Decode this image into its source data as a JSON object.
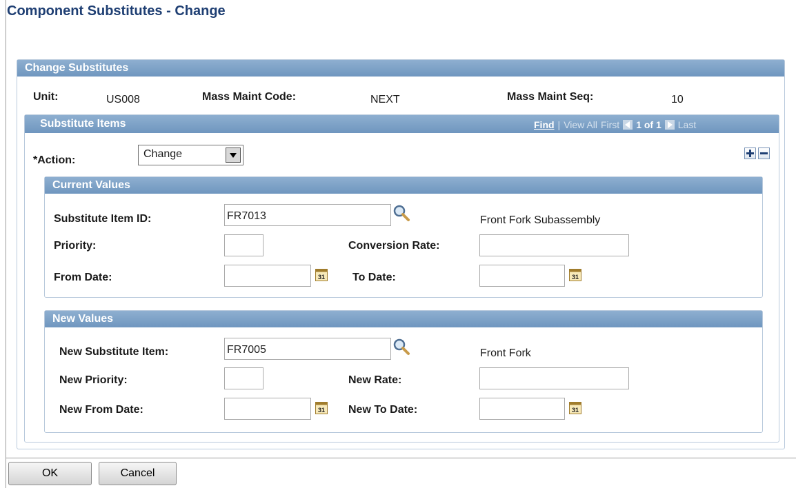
{
  "page_title": "Component Substitutes - Change",
  "change_substitutes": {
    "header": "Change Substitutes",
    "unit_label": "Unit:",
    "unit_value": "US008",
    "mm_code_label": "Mass Maint Code:",
    "mm_code_value": "NEXT",
    "mm_seq_label": "Mass Maint Seq:",
    "mm_seq_value": "10"
  },
  "substitute_items": {
    "header": "Substitute Items",
    "nav": {
      "find": "Find",
      "sep": "|",
      "view_all": "View All",
      "first": "First",
      "count": "1 of 1",
      "last": "Last"
    },
    "action_label": "*Action:",
    "action_value": "Change"
  },
  "current_values": {
    "header": "Current Values",
    "item_id_label": "Substitute Item ID:",
    "item_id_value": "FR7013",
    "item_desc": "Front Fork Subassembly",
    "priority_label": "Priority:",
    "priority_value": "",
    "conversion_label": "Conversion Rate:",
    "conversion_value": "",
    "from_label": "From Date:",
    "from_value": "",
    "to_label": "To Date:",
    "to_value": ""
  },
  "new_values": {
    "header": "New Values",
    "item_label": "New Substitute Item:",
    "item_value": "FR7005",
    "item_desc": "Front Fork",
    "priority_label": "New Priority:",
    "priority_value": "",
    "rate_label": "New Rate:",
    "rate_value": "",
    "from_label": "New From Date:",
    "from_value": "",
    "to_label": "New To Date:",
    "to_value": ""
  },
  "buttons": {
    "ok": "OK",
    "cancel": "Cancel"
  },
  "icons": {
    "lookup": "magnifier-icon",
    "calendar": "calendar-icon",
    "calendar_text": "31",
    "add_row": "plus-icon",
    "delete_row": "minus-icon",
    "prev": "triangle-left-icon",
    "next": "triangle-right-icon",
    "dropdown": "triangle-down-icon"
  },
  "colors": {
    "title": "#1f3f73",
    "header_bg": "#7a9fc6",
    "border": "#b8c9dc"
  }
}
